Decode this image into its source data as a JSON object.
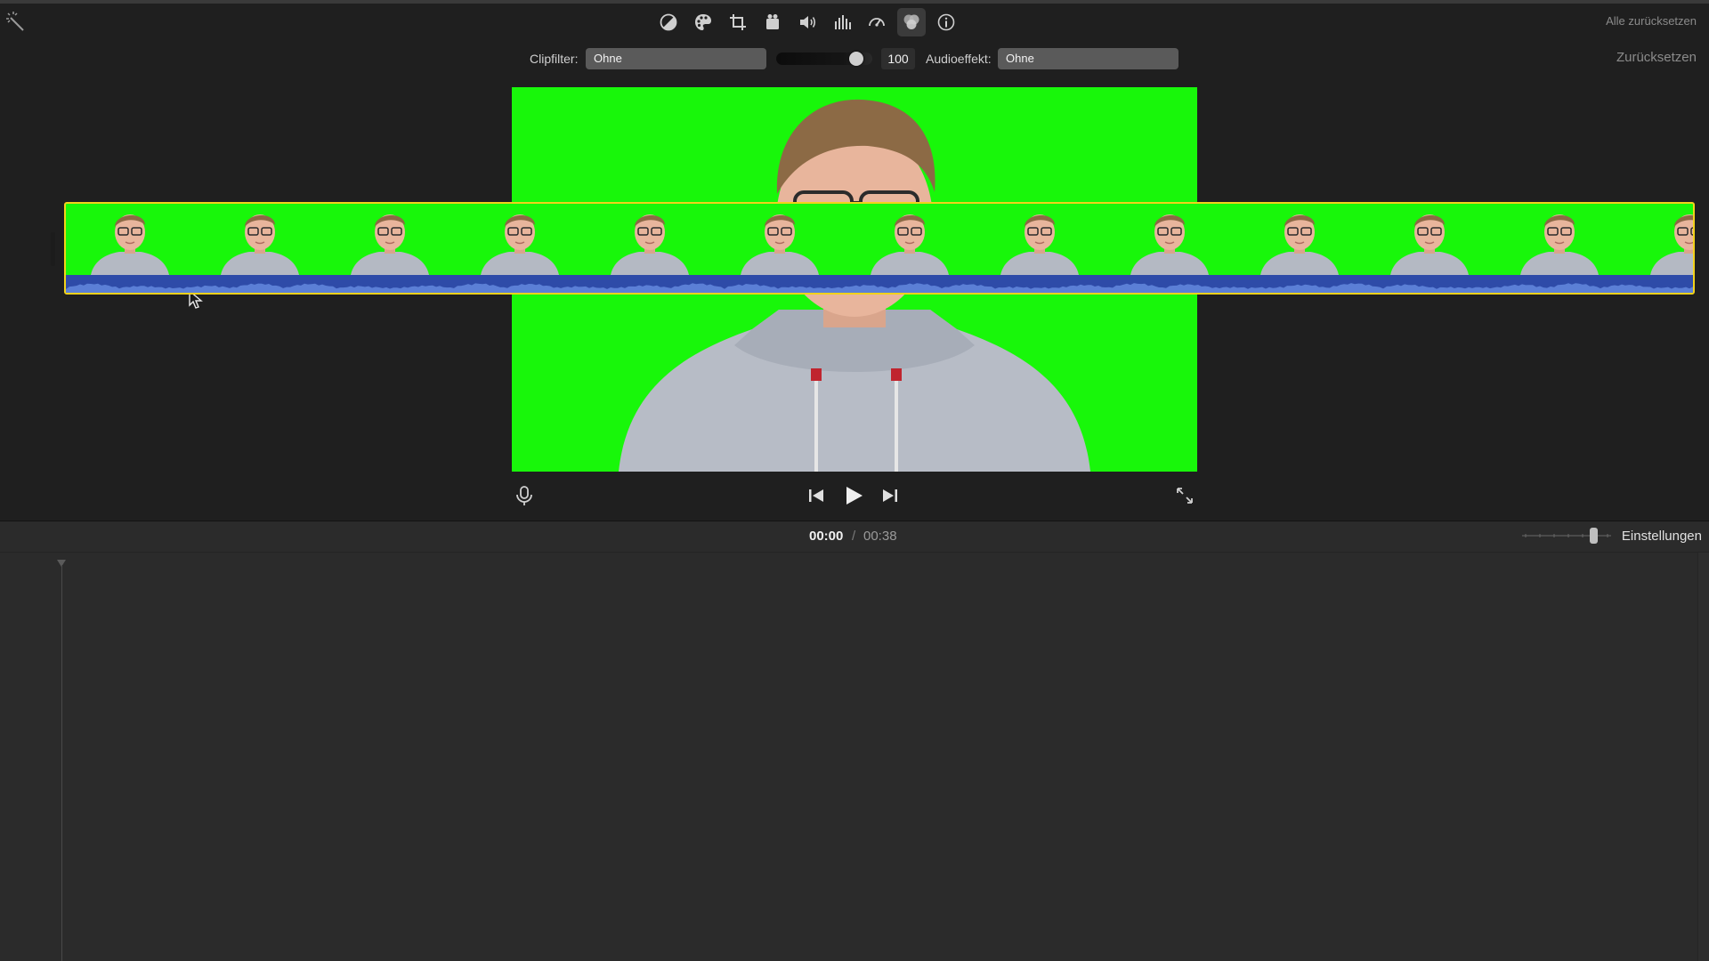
{
  "toolbar": {
    "icons": [
      "color-balance-icon",
      "color-correction-icon",
      "crop-icon",
      "stabilization-icon",
      "volume-icon",
      "noise-reduction-icon",
      "speed-icon",
      "clip-filter-icon",
      "info-icon"
    ],
    "active": "clip-filter-icon",
    "reset_all": "Alle zurücksetzen",
    "reset": "Zurücksetzen"
  },
  "filters": {
    "clip_filter_label": "Clipfilter:",
    "clip_filter_value": "Ohne",
    "amount_value": "100",
    "amount_level": 0.82,
    "audio_effect_label": "Audioeffekt:",
    "audio_effect_value": "Ohne"
  },
  "playback": {
    "current_time": "00:00",
    "separator": "/",
    "total_time": "00:38"
  },
  "timeline": {
    "settings_label": "Einstellungen",
    "clip_frame_count": 13
  },
  "colors": {
    "green_screen": "#18f70a",
    "clip_border": "#f2d21b",
    "audio_wave": "#2e4ba8"
  }
}
